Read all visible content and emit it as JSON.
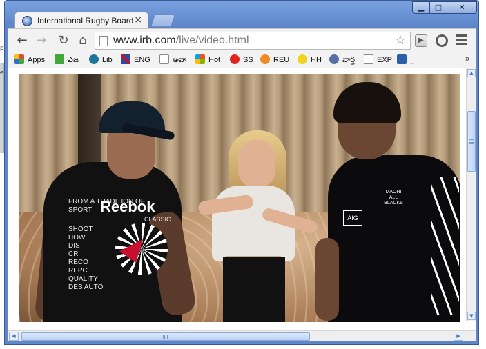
{
  "window": {
    "tab_title": "International Rugby Board",
    "tab_close": "×",
    "controls": {
      "minimize": "▁",
      "maximize": "□",
      "close": "✕"
    }
  },
  "toolbar": {
    "back": "←",
    "forward": "→",
    "reload": "↻",
    "home": "⌂",
    "url_host": "www.irb.com",
    "url_path": "/live/video.html",
    "star": "☆"
  },
  "bookmarks": [
    {
      "label": "Apps",
      "icon": "apps-grid-icon",
      "color": "#e24a3b"
    },
    {
      "label": "ఎజ",
      "icon": "green-square-icon",
      "color": "#42a83b"
    },
    {
      "label": "Lib",
      "icon": "wordpress-icon",
      "color": "#21759b"
    },
    {
      "label": "ENG",
      "icon": "uk-flag-icon",
      "color": "#2a4aa0"
    },
    {
      "label": "అవా",
      "icon": "blank-page-icon",
      "color": "#ffffff"
    },
    {
      "label": "Hot",
      "icon": "windows-flag-icon",
      "color": "#f4a019"
    },
    {
      "label": "SS",
      "icon": "swirl-s-icon",
      "color": "#e1251b"
    },
    {
      "label": "REU",
      "icon": "orange-circle-icon",
      "color": "#f08a24"
    },
    {
      "label": "HH",
      "icon": "yellow-e-icon",
      "color": "#f1d11b"
    },
    {
      "label": "వార్త",
      "icon": "feather-icon",
      "color": "#5a6fa8"
    },
    {
      "label": "EXP",
      "icon": "blank-page-icon",
      "color": "#ffffff"
    },
    {
      "label": "_",
      "icon": "blue-8-icon",
      "color": "#2b5fa8"
    }
  ],
  "bookmarks_more": "»",
  "video": {
    "shirt_brand": "Reebok",
    "shirt_sub": "CLASSIC",
    "shirt_lines": [
      "FROM A TRADITION OF",
      "SPORT",
      "SHOOT",
      "HOW",
      "DIS",
      "CR",
      "RECO",
      "REPC",
      "QUALITY",
      "DES AUTO"
    ],
    "sponsor": "AIG",
    "team_badge": "MAORI ALL BLACKS"
  },
  "left_desktop_text": [
    "Fo",
    "e"
  ]
}
